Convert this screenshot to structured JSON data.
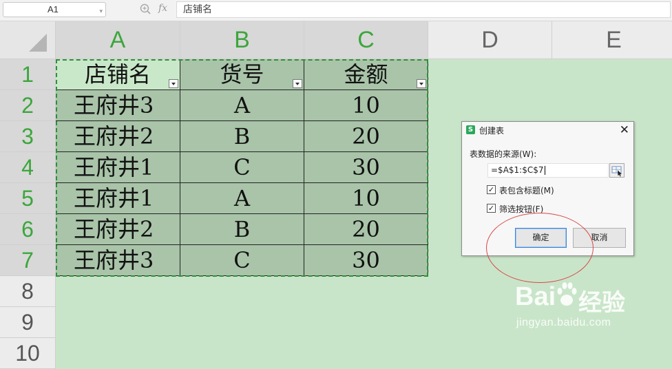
{
  "formula_bar": {
    "name_box": "A1",
    "fx": "fx",
    "content": "店铺名"
  },
  "columns": [
    "A",
    "B",
    "C",
    "D",
    "E"
  ],
  "rows": [
    "1",
    "2",
    "3",
    "4",
    "5",
    "6",
    "7",
    "8",
    "9",
    "10"
  ],
  "table": {
    "headers": [
      "店铺名",
      "货号",
      "金额"
    ],
    "rows": [
      [
        "王府井3",
        "A",
        "10"
      ],
      [
        "王府井2",
        "B",
        "20"
      ],
      [
        "王府井1",
        "C",
        "30"
      ],
      [
        "王府井1",
        "A",
        "10"
      ],
      [
        "王府井2",
        "B",
        "20"
      ],
      [
        "王府井3",
        "C",
        "30"
      ]
    ]
  },
  "dialog": {
    "icon": "S",
    "title": "创建表",
    "close": "✕",
    "source_label": "表数据的来源(W):",
    "source_value": "=$A$1:$C$7",
    "has_headers_label": "表包含标题(M)",
    "has_headers_checked": true,
    "filter_label": "筛选按钮(F)",
    "filter_checked": true,
    "ok": "确定",
    "cancel": "取消"
  },
  "watermark": {
    "brand": "Bai",
    "product": "经验",
    "url": "jingyan.baidu.com"
  },
  "colors": {
    "selected_header_text": "#3ca63c",
    "selection_fill": "#a9c4a9",
    "header_row_fill": "#c9e8c9",
    "sheet_tint": "#c9e5c9",
    "annotation": "#d84646"
  }
}
